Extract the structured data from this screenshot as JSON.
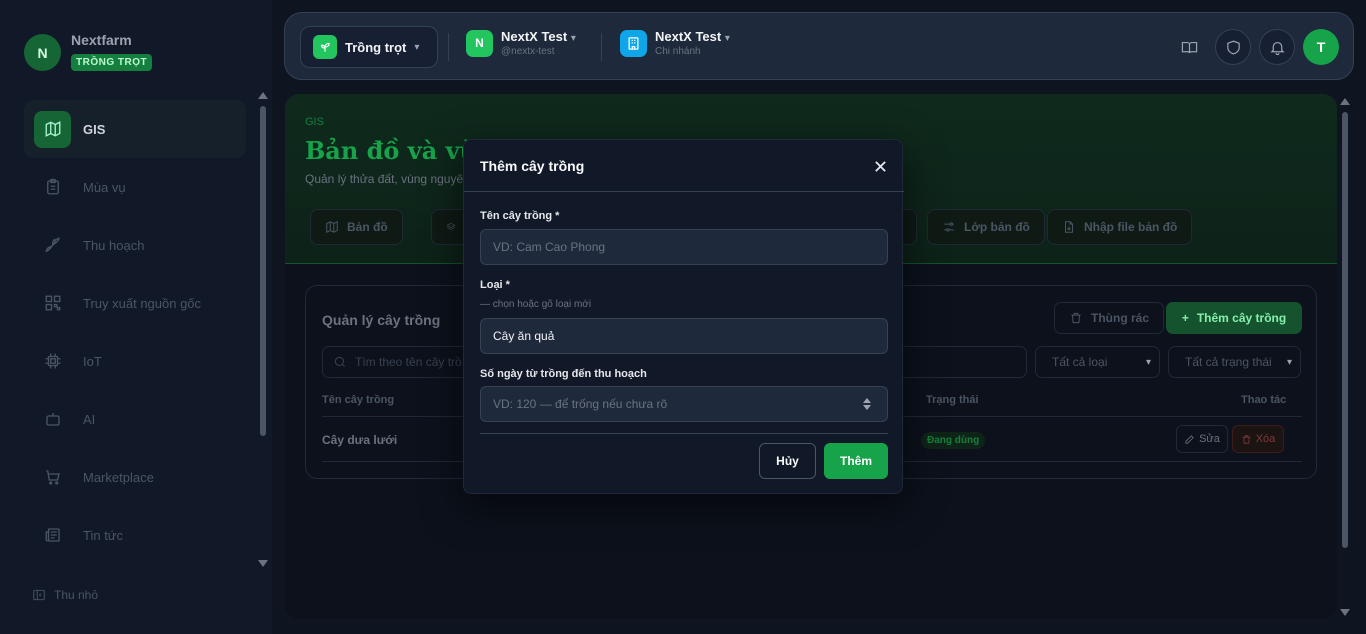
{
  "brand": {
    "avatar": "N",
    "name": "Nextfarm",
    "badge": "TRỒNG TRỌT"
  },
  "sidebar": {
    "items": [
      {
        "label": "GIS",
        "icon": "map-icon",
        "active": true
      },
      {
        "label": "Mùa vụ",
        "icon": "clipboard-icon"
      },
      {
        "label": "Thu hoạch",
        "icon": "wheat-icon"
      },
      {
        "label": "Truy xuất nguồn gốc",
        "icon": "qr-code-icon"
      },
      {
        "label": "IoT",
        "icon": "chip-icon"
      },
      {
        "label": "AI",
        "icon": "bot-icon"
      },
      {
        "label": "Marketplace",
        "icon": "cart-icon"
      },
      {
        "label": "Tin tức",
        "icon": "newspaper-icon"
      }
    ],
    "collapse_label": "Thu nhỏ"
  },
  "header": {
    "module_select": "Trồng trọt",
    "org": {
      "avatar": "N",
      "name": "NextX Test",
      "handle": "@nextx-test"
    },
    "branch": {
      "name": "NextX Test",
      "sub": "Chi nhánh"
    },
    "user_avatar": "T"
  },
  "hero": {
    "crumb": "GIS",
    "title": "Bản đồ và vùn",
    "subtitle": "Quản lý thửa đất, vùng nguyê",
    "tabs": [
      "Bản đồ",
      "Lớp bản đồ",
      "Nhập file bản đồ"
    ]
  },
  "card": {
    "title": "Quản lý cây trồng",
    "trash_label": "Thùng rác",
    "add_label": "Thêm cây trồng",
    "search_placeholder": "Tìm theo tên cây trồ",
    "filter_type": "Tất cả loại",
    "filter_status": "Tất cả trạng thái",
    "columns": {
      "name": "Tên cây trồng",
      "status": "Trạng thái",
      "actions": "Thao tác"
    },
    "rows": [
      {
        "name": "Cây dưa lưới",
        "status": "Đang dùng"
      }
    ],
    "edit_label": "Sửa",
    "delete_label": "Xóa"
  },
  "modal": {
    "title": "Thêm cây trồng",
    "name_label": "Tên cây trồng *",
    "name_placeholder": "VD: Cam Cao Phong",
    "type_label": "Loại *",
    "type_hint": "— chọn hoặc gõ loại mới",
    "type_value": "Cây ăn quả",
    "days_label": "Số ngày từ trồng đến thu hoạch",
    "days_placeholder": "VD: 120 — để trống nếu chưa rõ",
    "cancel_label": "Hủy",
    "submit_label": "Thêm"
  },
  "colors": {
    "accent": "#16a34a",
    "background": "#0f1520",
    "panel": "#111827"
  }
}
